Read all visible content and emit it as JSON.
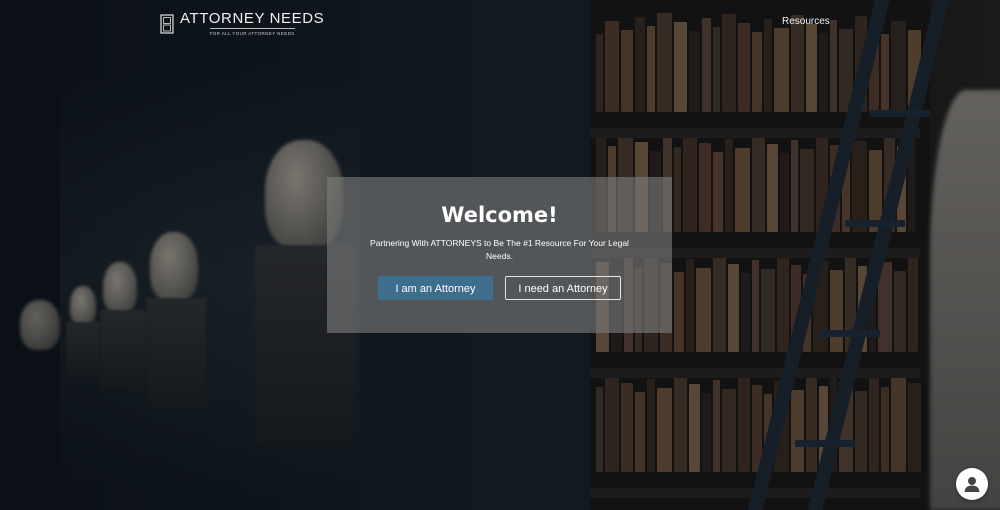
{
  "header": {
    "logo_title": "ATTORNEY NEEDS",
    "logo_tagline": "FOR ALL YOUR ATTORNEY NEEDS",
    "nav": {
      "resources_label": "Resources"
    }
  },
  "modal": {
    "title": "Welcome!",
    "subtitle": "Partnering With ATTORNEYS to Be The #1 Resource For Your Legal Needs.",
    "primary_button": "I am an Attorney",
    "secondary_button": "I need an Attorney"
  },
  "chat": {
    "icon": "user-avatar-icon"
  },
  "colors": {
    "primary_button": "#3e6e8d",
    "modal_background": "rgba(125,125,125,0.62)",
    "text": "#ffffff"
  }
}
